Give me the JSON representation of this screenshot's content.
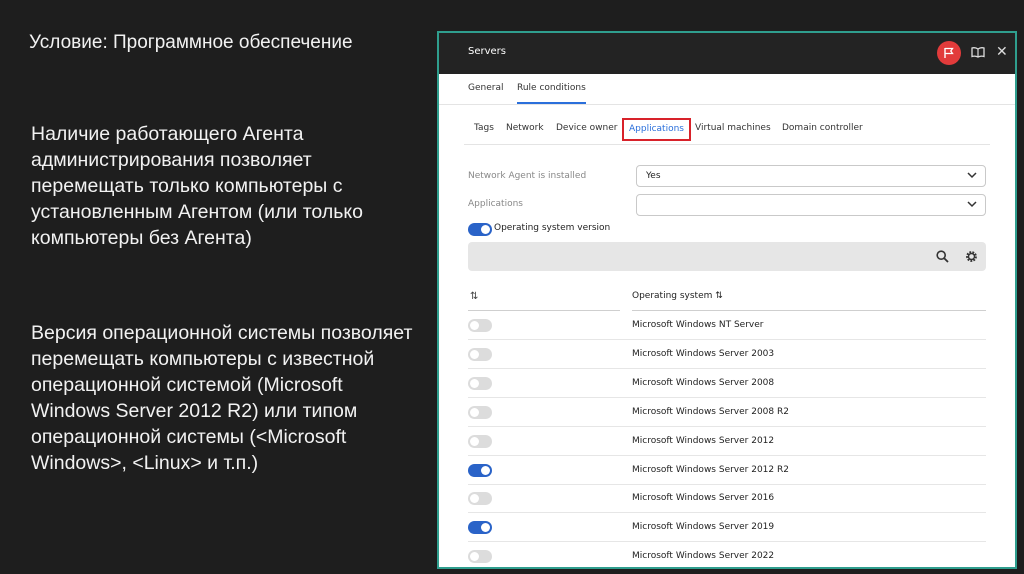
{
  "slide": {
    "title": "Условие: Программное обеспечение",
    "paragraph1": "Наличие работающего Агента администрирования позволяет перемещать только компьютеры с установленным Агентом (или только компьютеры без Агента)",
    "paragraph2": "Версия операционной системы позволяет перемещать компьютеры с известной операционной системой (Microsoft Windows Server 2012 R2) или типом операционной системы (<Microsoft Windows>, <Linux> и т.п.)"
  },
  "window": {
    "title": "Servers",
    "tabs": [
      {
        "label": "General",
        "active": false
      },
      {
        "label": "Rule conditions",
        "active": true
      }
    ],
    "subtabs": [
      {
        "label": "Tags",
        "active": false
      },
      {
        "label": "Network",
        "active": false
      },
      {
        "label": "Device owner",
        "active": false
      },
      {
        "label": "Applications",
        "active": true
      },
      {
        "label": "Virtual machines",
        "active": false
      },
      {
        "label": "Domain controller",
        "active": false
      }
    ],
    "network_agent": {
      "label": "Network Agent is installed",
      "value": "Yes"
    },
    "applications": {
      "label": "Applications",
      "value": ""
    },
    "os_version_toggle": {
      "label": "Operating system version",
      "on": true
    },
    "table": {
      "sort_icon": "⇅",
      "column_header": "Operating system ⇅",
      "rows": [
        {
          "name": "Microsoft Windows NT Server",
          "on": false
        },
        {
          "name": "Microsoft Windows Server 2003",
          "on": false
        },
        {
          "name": "Microsoft Windows Server 2008",
          "on": false
        },
        {
          "name": "Microsoft Windows Server 2008 R2",
          "on": false
        },
        {
          "name": "Microsoft Windows Server 2012",
          "on": false
        },
        {
          "name": "Microsoft Windows Server 2012 R2",
          "on": true
        },
        {
          "name": "Microsoft Windows Server 2016",
          "on": false
        },
        {
          "name": "Microsoft Windows Server 2019",
          "on": true
        },
        {
          "name": "Microsoft Windows Server 2022",
          "on": false
        }
      ]
    }
  },
  "colors": {
    "accent_blue": "#2a63c8",
    "highlight_red": "#d8222a",
    "window_border": "#2f9e8e"
  }
}
